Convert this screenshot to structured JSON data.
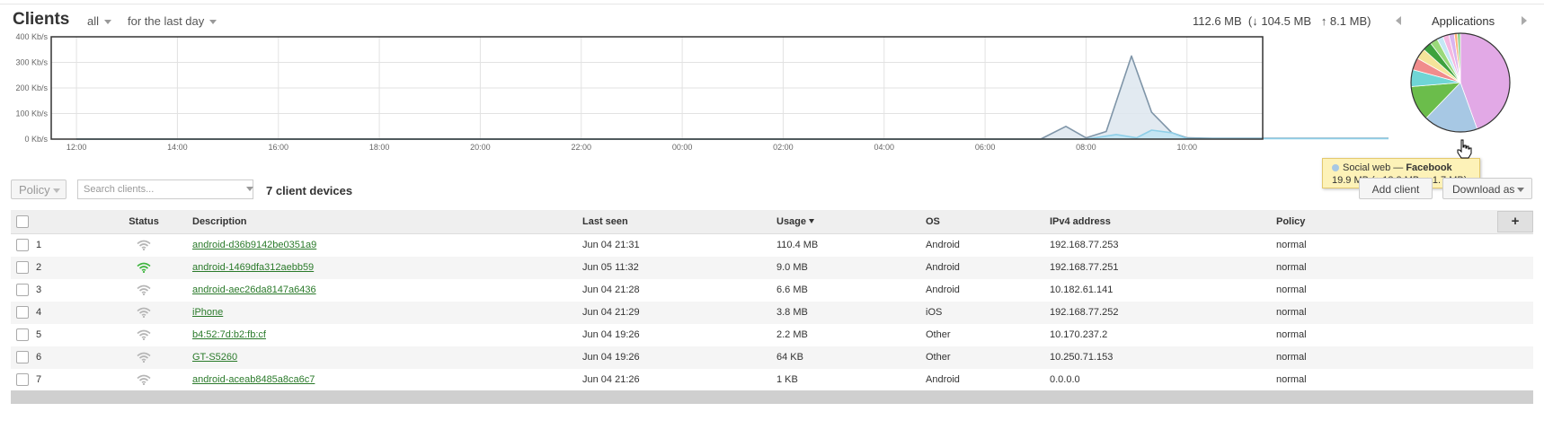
{
  "header": {
    "title": "Clients",
    "filter_group": "all",
    "filter_time": "for the last day",
    "usage_summary": "112.6 MB  (↓ 104.5 MB   ↑ 8.1 MB)",
    "applications_label": "Applications"
  },
  "chart_data": {
    "type": "area",
    "y_ticks": [
      "0 Kb/s",
      "100 Kb/s",
      "200 Kb/s",
      "300 Kb/s",
      "400 Kb/s"
    ],
    "ylim": [
      0,
      400
    ],
    "x_ticks": [
      "12:00",
      "14:00",
      "16:00",
      "18:00",
      "20:00",
      "22:00",
      "00:00",
      "02:00",
      "04:00",
      "06:00",
      "08:00",
      "10:00"
    ],
    "grid": true,
    "series": [
      {
        "role": "total",
        "color": "#7f95a8",
        "fill": "#dde6ee",
        "x_hours": [
          0,
          19.1,
          19.6,
          20.0,
          20.4,
          20.9,
          21.3,
          21.7,
          22.0,
          22.5,
          34.8,
          35.3,
          35.8,
          36.1
        ],
        "values": [
          0,
          0,
          50,
          5,
          30,
          325,
          105,
          25,
          5,
          3,
          3,
          55,
          10,
          0
        ]
      },
      {
        "role": "received",
        "color": "#8ecfe8",
        "fill": "#bfe4f3",
        "x_hours": [
          0,
          20.0,
          20.6,
          21.0,
          21.3,
          21.7,
          22.0,
          34.9,
          35.3,
          35.8,
          36.1
        ],
        "values": [
          0,
          0,
          18,
          5,
          35,
          25,
          2,
          2,
          40,
          5,
          0
        ]
      }
    ]
  },
  "pie_chart": {
    "type": "pie",
    "slices": [
      {
        "value": 44.5,
        "color": "#e2a9e6"
      },
      {
        "value": 17.7,
        "color": "#a7c8e4"
      },
      {
        "value": 11.5,
        "color": "#6bbd4b"
      },
      {
        "value": 5.5,
        "color": "#6fd5d5"
      },
      {
        "value": 4.0,
        "color": "#f08c8c"
      },
      {
        "value": 3.5,
        "color": "#f5e49a"
      },
      {
        "value": 3.0,
        "color": "#3da23d"
      },
      {
        "value": 2.5,
        "color": "#9ad97a"
      },
      {
        "value": 2.0,
        "color": "#c4e8f5"
      },
      {
        "value": 2.0,
        "color": "#f5b8e0"
      },
      {
        "value": 1.8,
        "color": "#d9b4f0"
      },
      {
        "value": 1.0,
        "color": "#ffb27a"
      },
      {
        "value": 1.0,
        "color": "#8bd18b"
      }
    ]
  },
  "tooltip": {
    "category": "Social web",
    "sep": " — ",
    "app": "Facebook",
    "detail": "19.9 MB (↓ 18.2 MB, ↑ 1.7 MB)"
  },
  "toolbar": {
    "policy_label": "Policy",
    "search_placeholder": "Search clients...",
    "device_count": "7 client devices",
    "add_client": "Add client",
    "download_as": "Download as"
  },
  "table": {
    "columns": {
      "status": "Status",
      "description": "Description",
      "last_seen": "Last seen",
      "usage": "Usage",
      "os": "OS",
      "ipv4": "IPv4 address",
      "policy": "Policy"
    },
    "plus_label": "+",
    "rows": [
      {
        "num": "1",
        "online": false,
        "description": "android-d36b9142be0351a9",
        "last_seen": "Jun 04 21:31",
        "usage": "110.4 MB",
        "os": "Android",
        "ipv4": "192.168.77.253",
        "policy": "normal"
      },
      {
        "num": "2",
        "online": true,
        "description": "android-1469dfa312aebb59",
        "last_seen": "Jun 05 11:32",
        "usage": "9.0 MB",
        "os": "Android",
        "ipv4": "192.168.77.251",
        "policy": "normal"
      },
      {
        "num": "3",
        "online": false,
        "description": "android-aec26da8147a6436",
        "last_seen": "Jun 04 21:28",
        "usage": "6.6 MB",
        "os": "Android",
        "ipv4": "10.182.61.141",
        "policy": "normal"
      },
      {
        "num": "4",
        "online": false,
        "description": "iPhone",
        "last_seen": "Jun 04 21:29",
        "usage": "3.8 MB",
        "os": "iOS",
        "ipv4": "192.168.77.252",
        "policy": "normal"
      },
      {
        "num": "5",
        "online": false,
        "description": "b4:52:7d:b2:fb:cf",
        "last_seen": "Jun 04 19:26",
        "usage": "2.2 MB",
        "os": "Other",
        "ipv4": "10.170.237.2",
        "policy": "normal"
      },
      {
        "num": "6",
        "online": false,
        "description": "GT-S5260",
        "last_seen": "Jun 04 19:26",
        "usage": "64 KB",
        "os": "Other",
        "ipv4": "10.250.71.153",
        "policy": "normal"
      },
      {
        "num": "7",
        "online": false,
        "description": "android-aceab8485a8ca6c7",
        "last_seen": "Jun 04 21:26",
        "usage": "1 KB",
        "os": "Android",
        "ipv4": "0.0.0.0",
        "policy": "normal"
      }
    ]
  },
  "colors": {
    "link": "#2a7a2a",
    "wifi_online": "#3fb53f",
    "wifi_offline": "#b5b5b5"
  }
}
